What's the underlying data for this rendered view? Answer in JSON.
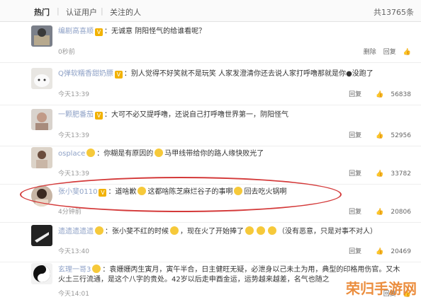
{
  "tabs": {
    "hot": "热门",
    "verified": "认证用户",
    "following": "关注的人",
    "total": "共13765条"
  },
  "comments": [
    {
      "name": "编剧高喜顺",
      "badge": "V",
      "text": "：无诚意 阴阳怪气的给谁看呢？",
      "time": "0秒前",
      "actions": [
        "删除",
        "回复"
      ],
      "likes": ""
    },
    {
      "name": "Q弹软糯香甜奶膘",
      "badge": "V",
      "text": "：别人觉得不好笑就不是玩笑 人家发澄清你还去说人家打呼噜那就是你",
      "suffix": "没跑了",
      "time": "今天13:39",
      "actions": [
        "回复"
      ],
      "likes": "56838"
    },
    {
      "name": "一颗肥番茄",
      "badge": "V",
      "text": "：大可不必又提呼噜，还说自己打呼噜世界第一，阴阳怪气",
      "time": "今天13:39",
      "actions": [
        "回复"
      ],
      "likes": "52956"
    },
    {
      "name": "osplace",
      "badge": "",
      "text": "：你糊是有原因的",
      "suffix": "马甲线带给你的路人缘快败光了",
      "time": "今天13:39",
      "actions": [
        "回复"
      ],
      "likes": "33782"
    },
    {
      "name": "张小斐0110",
      "badge": "V",
      "text": "：道啥歉",
      "mid": "这都啥陈芝麻烂谷子的事啊",
      "suffix": "回去吃火锅啊",
      "time": "4分钟前",
      "actions": [
        "回复"
      ],
      "likes": "20806"
    },
    {
      "name": "遗遗遗遗遗",
      "badge": "",
      "text": "：张小斐不红的时候",
      "suffix": "，现在火了开始捧了",
      "tail": "（没有恶意，只是对事不对人）",
      "time": "今天13:40",
      "actions": [
        "回复"
      ],
      "likes": "20469"
    },
    {
      "name": "玄理一哥3",
      "badge": "",
      "text": "：袁姗姗丙生寅月，寅午半合，日主健旺无疑，必泄身以己未土为用，典型的印格用伤官。又木火土三行流通，是这个八字的贵处。42岁以后走申酉金运，运势越来越差，名气也随之",
      "time": "今天14:01",
      "actions": [
        "回复"
      ],
      "likes": ""
    }
  ],
  "watermark": "荣归手游网",
  "colors": {
    "name": "#8fa2c7",
    "highlight": "#d43a3a",
    "crown": "#f2b200"
  }
}
